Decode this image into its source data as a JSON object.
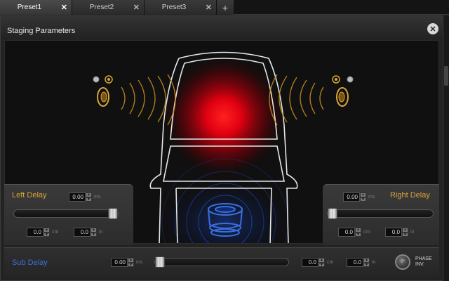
{
  "tabs": [
    {
      "label": "Preset1",
      "active": true
    },
    {
      "label": "Preset2",
      "active": false
    },
    {
      "label": "Preset3",
      "active": false
    }
  ],
  "tab_add_label": "+",
  "tab_close_glyph": "✕",
  "panel": {
    "title": "Staging Parameters",
    "close_glyph": "✕"
  },
  "left": {
    "title": "Left Delay",
    "delay_ms": {
      "value": "0.00",
      "unit": "ms"
    },
    "slider_level": 1.0,
    "cm": {
      "value": "0.0",
      "unit": "cm"
    },
    "in": {
      "value": "0.0",
      "unit": "in"
    }
  },
  "right": {
    "title": "Right Delay",
    "delay_ms": {
      "value": "0.00",
      "unit": "ms"
    },
    "slider_level": 0.0,
    "cm": {
      "value": "0.0",
      "unit": "cm"
    },
    "in": {
      "value": "0.0",
      "unit": "in"
    }
  },
  "sub": {
    "title": "Sub Delay",
    "delay_ms": {
      "value": "0.00",
      "unit": "ms"
    },
    "slider_level": 0.0,
    "cm": {
      "value": "0.0",
      "unit": "cm"
    },
    "in": {
      "value": "0.0",
      "unit": "in"
    },
    "phase_button_label": "0°",
    "phase_label_line1": "PHASE",
    "phase_label_line2": "INV."
  },
  "colors": {
    "gold": "#d9a43a",
    "blue": "#3a6fe0",
    "focus_red": "#ff1a1a"
  }
}
